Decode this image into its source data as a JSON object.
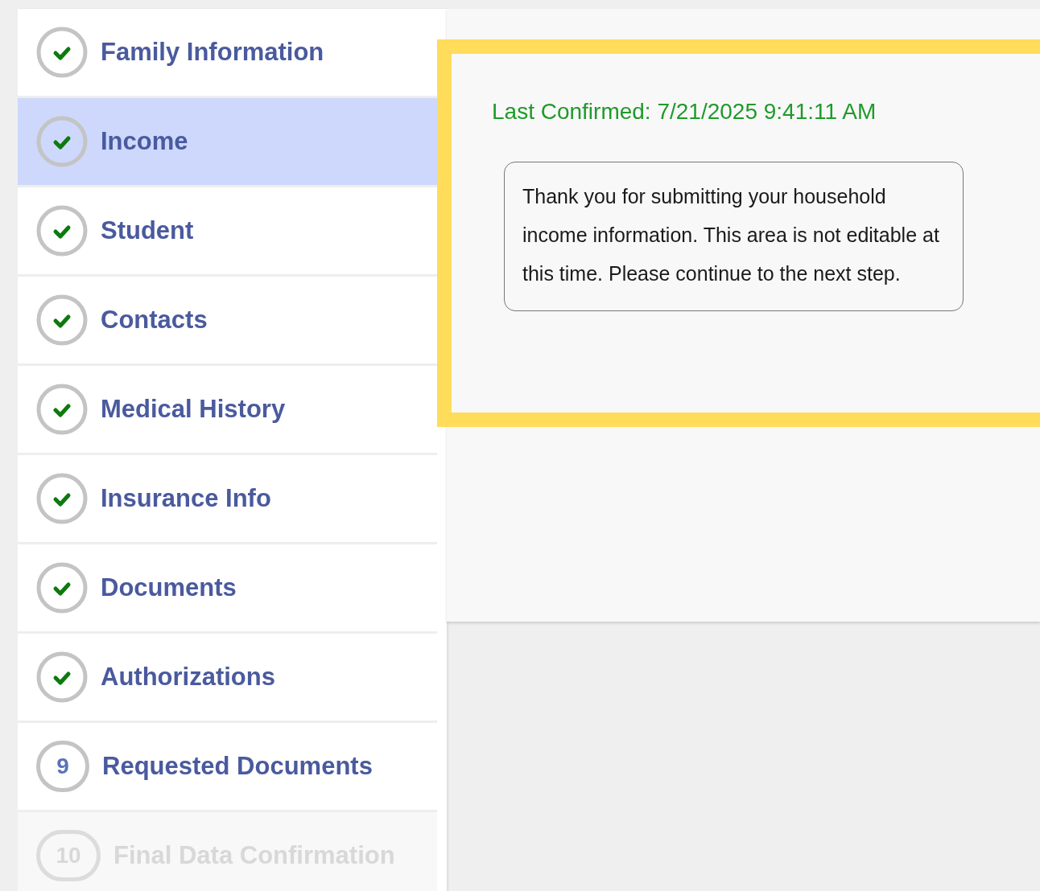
{
  "steps": [
    {
      "label": "Family Information",
      "kind": "done",
      "selected": false,
      "disabled": false
    },
    {
      "label": "Income",
      "kind": "done",
      "selected": true,
      "disabled": false
    },
    {
      "label": "Student",
      "kind": "done",
      "selected": false,
      "disabled": false
    },
    {
      "label": "Contacts",
      "kind": "done",
      "selected": false,
      "disabled": false
    },
    {
      "label": "Medical History",
      "kind": "done",
      "selected": false,
      "disabled": false
    },
    {
      "label": "Insurance Info",
      "kind": "done",
      "selected": false,
      "disabled": false
    },
    {
      "label": "Documents",
      "kind": "done",
      "selected": false,
      "disabled": false
    },
    {
      "label": "Authorizations",
      "kind": "done",
      "selected": false,
      "disabled": false
    },
    {
      "label": "Requested Documents",
      "kind": "number",
      "number": "9",
      "selected": false,
      "disabled": false
    },
    {
      "label": "Final Data Confirmation",
      "kind": "number",
      "number": "10",
      "selected": false,
      "disabled": true
    }
  ],
  "last_confirmed": "Last Confirmed: 7/21/2025 9:41:11 AM",
  "message": "Thank you for submitting your household income information. This area is not editable at this time. Please continue to the next step."
}
